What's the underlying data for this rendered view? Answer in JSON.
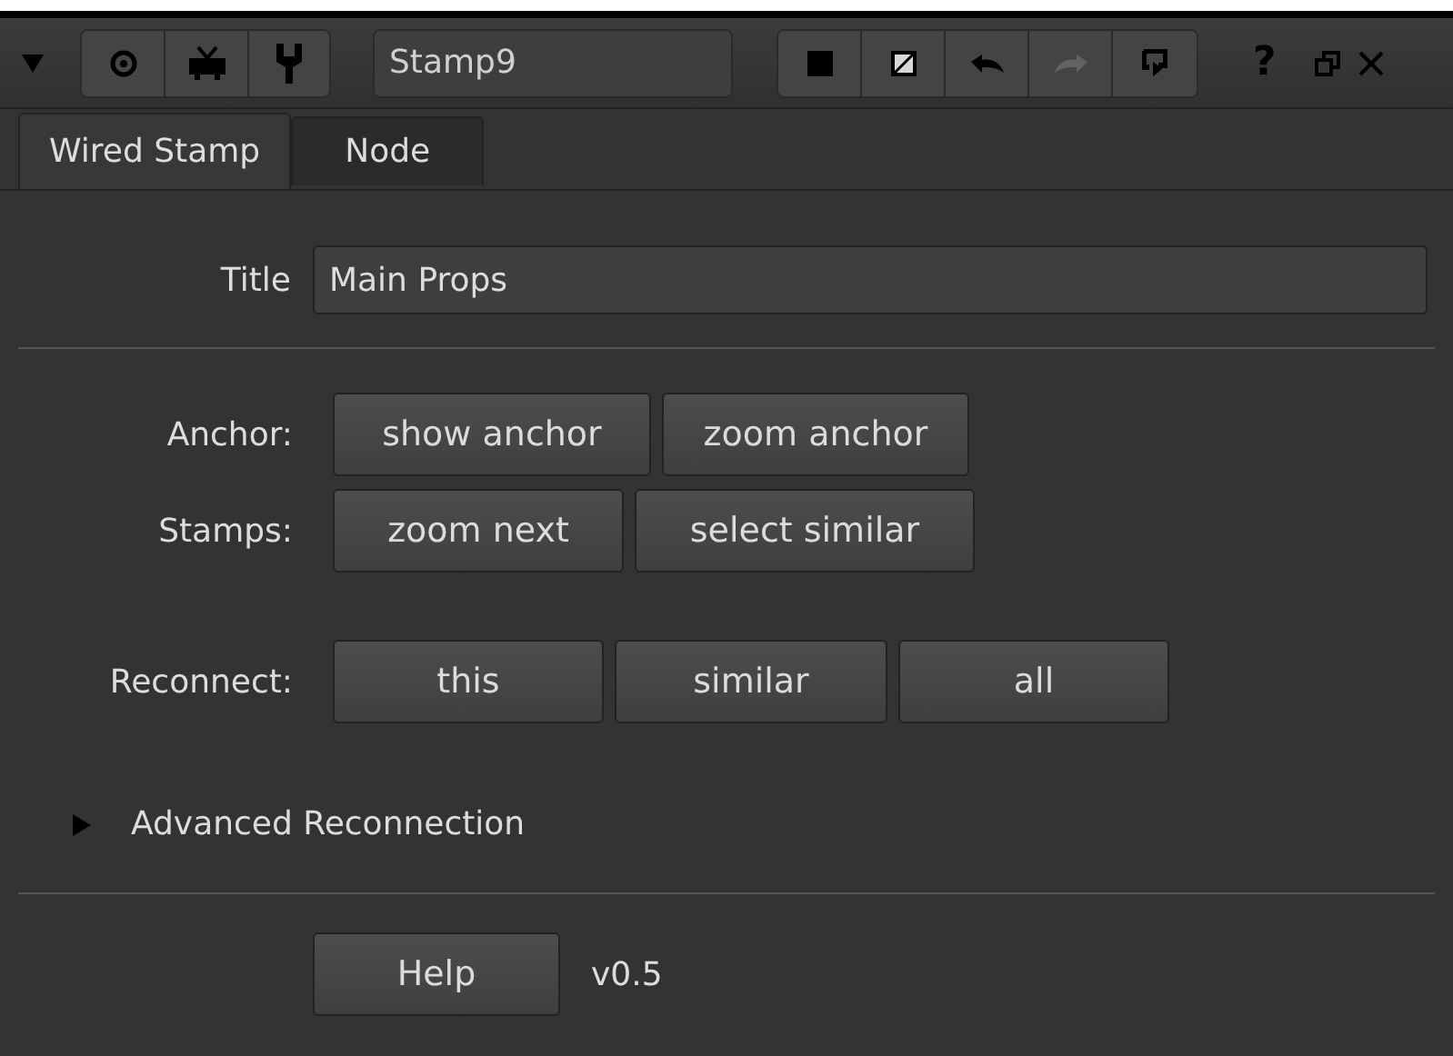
{
  "toolbar": {
    "node_name": "Stamp9",
    "tools": [
      {
        "kind": "solid",
        "disabled": false
      },
      {
        "kind": "diagonal",
        "disabled": false
      },
      {
        "kind": "undo",
        "disabled": false
      },
      {
        "kind": "redo",
        "disabled": true
      },
      {
        "kind": "revert",
        "disabled": false
      }
    ],
    "help_glyph": "?"
  },
  "tabs": [
    {
      "label": "Wired Stamp",
      "selected": true
    },
    {
      "label": "Node",
      "selected": false
    }
  ],
  "title_field": {
    "label": "Title",
    "value": "Main Props"
  },
  "button_rows": [
    {
      "label": "Anchor:",
      "buttons": [
        "show anchor",
        "zoom anchor"
      ]
    },
    {
      "label": "Stamps:",
      "buttons": [
        "zoom next",
        "select similar"
      ]
    },
    {
      "label": "Reconnect:",
      "buttons": [
        "this",
        "similar",
        "all"
      ]
    }
  ],
  "advanced": {
    "label": "Advanced Reconnection",
    "expanded": false
  },
  "footer": {
    "button": "Help",
    "version": "v0.5"
  }
}
